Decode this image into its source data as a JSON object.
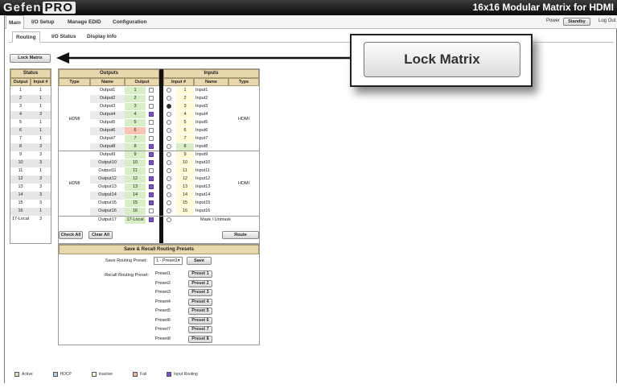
{
  "app": {
    "logo_main": "Gefen",
    "logo_pro": "PRO",
    "title": "16x16 Modular Matrix for HDMI"
  },
  "main_tabs": [
    "Main",
    "I/O Setup",
    "Manage EDID",
    "Configuration"
  ],
  "header_right": {
    "power_label": "Power",
    "standby": "Standby",
    "logout": "Log Out"
  },
  "sub_tabs": [
    "Routing",
    "I/O Status",
    "Display Info"
  ],
  "lock_button": "Lock Matrix",
  "callout_label": "Lock Matrix",
  "status": {
    "title": "Status",
    "col_output": "Output",
    "col_input": "Input #",
    "rows": [
      [
        "1",
        "1"
      ],
      [
        "2",
        "1"
      ],
      [
        "3",
        "1"
      ],
      [
        "4",
        "3"
      ],
      [
        "5",
        "1"
      ],
      [
        "6",
        "1"
      ],
      [
        "7",
        "1"
      ],
      [
        "8",
        "3"
      ],
      [
        "9",
        "3"
      ],
      [
        "10",
        "3"
      ],
      [
        "11",
        "1"
      ],
      [
        "12",
        "3"
      ],
      [
        "13",
        "3"
      ],
      [
        "14",
        "3"
      ],
      [
        "15",
        "3"
      ],
      [
        "16",
        "1"
      ],
      [
        "17-Local",
        "3"
      ]
    ]
  },
  "outputs": {
    "title": "Outputs",
    "col_type": "Type",
    "col_name": "Name",
    "col_output": "Output",
    "type_label": "HDMI",
    "rows": [
      {
        "name": "Output1",
        "num": "1",
        "checked": false
      },
      {
        "name": "Output2",
        "num": "2",
        "checked": false
      },
      {
        "name": "Output3",
        "num": "3",
        "checked": false
      },
      {
        "name": "Output4",
        "num": "4",
        "checked": true
      },
      {
        "name": "Output5",
        "num": "5",
        "checked": false
      },
      {
        "name": "Output6",
        "num": "6",
        "checked": false
      },
      {
        "name": "Output7",
        "num": "7",
        "checked": false
      },
      {
        "name": "Output8",
        "num": "8",
        "checked": true
      },
      {
        "name": "Output9",
        "num": "9",
        "checked": true
      },
      {
        "name": "Output10",
        "num": "10",
        "checked": true
      },
      {
        "name": "Output11",
        "num": "11",
        "checked": false
      },
      {
        "name": "Output12",
        "num": "12",
        "checked": true
      },
      {
        "name": "Output13",
        "num": "13",
        "checked": true
      },
      {
        "name": "Output14",
        "num": "14",
        "checked": true
      },
      {
        "name": "Output15",
        "num": "15",
        "checked": true
      },
      {
        "name": "Output16",
        "num": "16",
        "checked": false
      }
    ],
    "local": {
      "name": "Output17",
      "num": "17-Local",
      "checked": true
    }
  },
  "inputs": {
    "title": "Inputs",
    "col_input": "Input #",
    "col_name": "Name",
    "col_type": "Type",
    "type_label": "HDMI",
    "selected": 3,
    "rows": [
      {
        "num": "1",
        "name": "Input1"
      },
      {
        "num": "2",
        "name": "Input2"
      },
      {
        "num": "3",
        "name": "Input3"
      },
      {
        "num": "4",
        "name": "Input4"
      },
      {
        "num": "5",
        "name": "Input5"
      },
      {
        "num": "6",
        "name": "Input6"
      },
      {
        "num": "7",
        "name": "Input7"
      },
      {
        "num": "8",
        "name": "Input8"
      },
      {
        "num": "9",
        "name": "Input9"
      },
      {
        "num": "10",
        "name": "Input10"
      },
      {
        "num": "11",
        "name": "Input11"
      },
      {
        "num": "12",
        "name": "Input12"
      },
      {
        "num": "13",
        "name": "Input13"
      },
      {
        "num": "14",
        "name": "Input14"
      },
      {
        "num": "15",
        "name": "Input15"
      },
      {
        "num": "16",
        "name": "Input16"
      }
    ],
    "mask": "Mask / Unmask"
  },
  "buttons": {
    "check_all": "Check All",
    "clear_all": "Clear All",
    "route": "Route"
  },
  "presets": {
    "title": "Save & Recall Routing Presets",
    "save_label": "Save Routing Preset:",
    "save_select": "1 - Preset1",
    "save_button": "Save",
    "recall_label": "Recall Routing Preset:",
    "items": [
      {
        "name": "Preset1",
        "button": "Preset 1"
      },
      {
        "name": "Preset2",
        "button": "Preset 2"
      },
      {
        "name": "Preset3",
        "button": "Preset 3"
      },
      {
        "name": "Preset4",
        "button": "Preset 4"
      },
      {
        "name": "Preset5",
        "button": "Preset 5"
      },
      {
        "name": "Preset6",
        "button": "Preset 6"
      },
      {
        "name": "Preset7",
        "button": "Preset 7"
      },
      {
        "name": "Preset8",
        "button": "Preset 8"
      }
    ]
  },
  "legend": [
    {
      "label": "Active",
      "color": "#cfe9b8"
    },
    {
      "label": "HDCP",
      "color": "#a8d4f0"
    },
    {
      "label": "Inactive",
      "color": "#fffbd0"
    },
    {
      "label": "Fail",
      "color": "#f6b59a"
    },
    {
      "label": "Input Routing",
      "color": "#7a4fd6"
    }
  ],
  "colors": {
    "active": "#d8efc6",
    "inactive": "#fffbd6",
    "fail": "#f9c4b0",
    "hdcp": "#bde0f5",
    "highlight": "#e3e3e3"
  }
}
